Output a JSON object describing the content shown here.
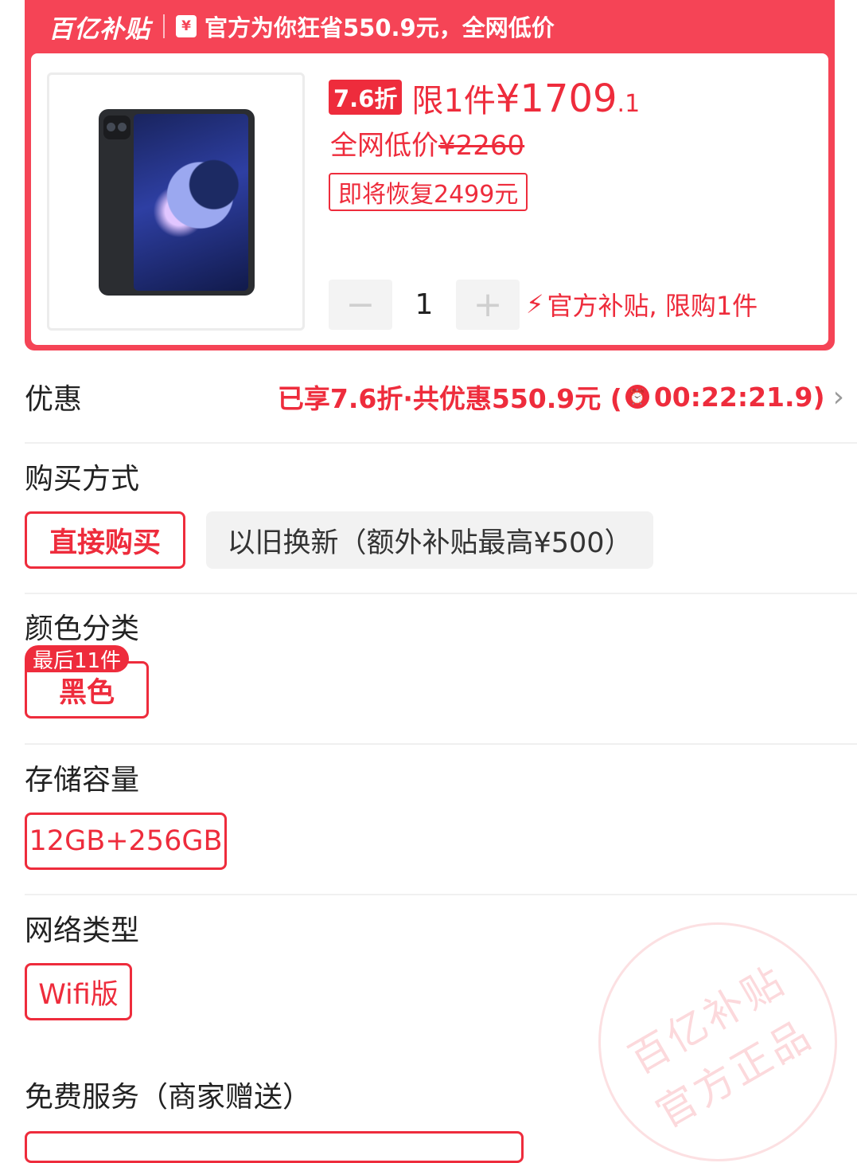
{
  "banner": {
    "brand": "百亿补贴",
    "yen_icon": "¥",
    "headline": "官方为你狂省550.9元，全网低价"
  },
  "product": {
    "image": "tablet-image",
    "discount_badge": "7.6折",
    "limit_text": "限1件",
    "price_main": "¥1709",
    "price_decimal": ".1",
    "orig_prefix": "全网低价",
    "orig_price": "¥2260",
    "restore_text": "即将恢复2499元",
    "minus_label": "−",
    "quantity": "1",
    "plus_label": "+",
    "subsidy_note": "官方补贴, 限购1件"
  },
  "promo": {
    "label": "优惠",
    "summary": "已享7.6折·共优惠550.9元 (",
    "countdown": "00:22:21.9)",
    "chevron": "›"
  },
  "purchase": {
    "title": "购买方式",
    "options": [
      "直接购买",
      "以旧换新（额外补贴最高¥500）"
    ]
  },
  "color": {
    "title": "颜色分类",
    "stock_badge": "最后11件",
    "options": [
      "黑色"
    ]
  },
  "storage": {
    "title": "存储容量",
    "options": [
      "12GB+256GB"
    ]
  },
  "network": {
    "title": "网络类型",
    "options": [
      "Wifi版"
    ]
  },
  "services": {
    "title": "免费服务（商家赠送）"
  },
  "stamp": {
    "line1": "百亿补贴",
    "line2": "官方正品"
  },
  "colors": {
    "accent": "#ee2c3c",
    "banner": "#f54456"
  }
}
